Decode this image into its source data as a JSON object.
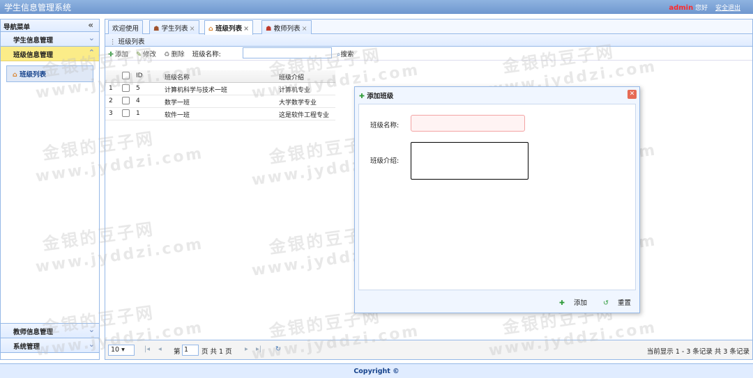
{
  "header": {
    "title": "学生信息管理系统",
    "user": "admin",
    "greeting": "您好",
    "logout": "安全退出"
  },
  "sidebar": {
    "title": "导航菜单",
    "sections": [
      {
        "label": "学生信息管理"
      },
      {
        "label": "班级信息管理"
      },
      {
        "label": "教师信息管理"
      },
      {
        "label": "系统管理"
      }
    ],
    "item": "班级列表"
  },
  "tabs": [
    {
      "label": "欢迎使用"
    },
    {
      "label": "学生列表"
    },
    {
      "label": "班级列表"
    },
    {
      "label": "教师列表"
    }
  ],
  "panel": {
    "title": "班级列表"
  },
  "toolbar": {
    "add": "添加",
    "edit": "修改",
    "delete": "删除",
    "search_label": "班级名称:",
    "search": "搜索",
    "search_value": ""
  },
  "table": {
    "headers": [
      "ID",
      "班级名称",
      "班级介绍"
    ],
    "rows": [
      {
        "n": "1",
        "id": "5",
        "name": "计算机科学与技术一班",
        "intro": "计算机专业"
      },
      {
        "n": "2",
        "id": "4",
        "name": "数学一班",
        "intro": "大学数学专业"
      },
      {
        "n": "3",
        "id": "1",
        "name": "软件一班",
        "intro": "这是软件工程专业"
      }
    ]
  },
  "pager": {
    "page_size": "10",
    "page_prefix": "第",
    "page_value": "1",
    "page_suffix": "页 共 1 页",
    "info": "当前显示 1 - 3 条记录 共 3 条记录"
  },
  "dialog": {
    "title": "添加班级",
    "name_label": "班级名称:",
    "intro_label": "班级介绍:",
    "add": "添加",
    "reset": "重置",
    "name_value": "",
    "intro_value": ""
  },
  "footer": "Copyright ©",
  "watermark": {
    "line1": "金银的豆子网",
    "line2": "www.jyddzi.com"
  }
}
